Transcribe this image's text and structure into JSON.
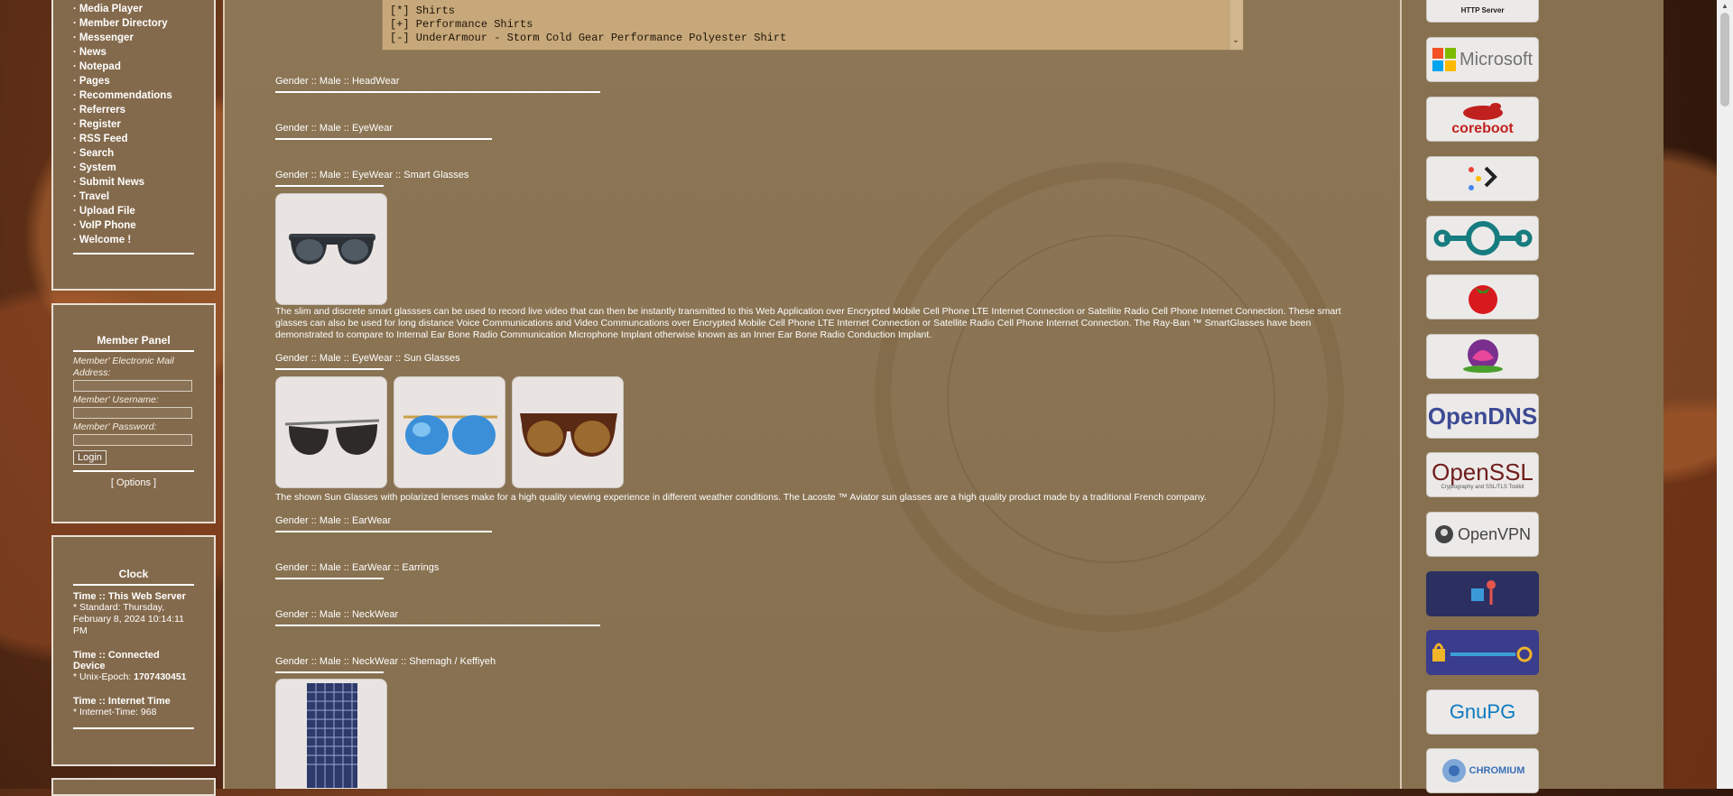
{
  "nav": {
    "items": [
      "Media Player",
      "Member Directory",
      "Messenger",
      "News",
      "Notepad",
      "Pages",
      "Recommendations",
      "Referrers",
      "Register",
      "RSS Feed",
      "Search",
      "System",
      "Submit News",
      "Travel",
      "Upload File",
      "VoIP Phone",
      "Welcome !"
    ],
    "bullet": "·"
  },
  "member_panel": {
    "title": "Member Panel",
    "email_label": "Member' Electronic Mail Address:",
    "username_label": "Member' Username:",
    "password_label": "Member' Password:",
    "login_label": "Login",
    "options_label": "[ Options ]"
  },
  "clock": {
    "title": "Clock",
    "server_heading": "Time :: This Web Server",
    "server_text": "* Standard: Thursday, February 8, 2024 10:14:11 PM",
    "device_heading": "Time :: Connected Device",
    "device_prefix": "* Unix-Epoch: ",
    "device_value": "1707430451",
    "internet_heading": "Time :: Internet Time",
    "internet_text": "* Internet-Time: 968"
  },
  "textbox": {
    "lines": [
      "[*] Shirts",
      "[+] Performance Shirts",
      "[-] UnderArmour - Storm Cold Gear Performance Polyester Shirt"
    ],
    "scroll_arrow": "⌄"
  },
  "sections": [
    {
      "title": "Gender :: Male :: HeadWear"
    },
    {
      "title": "Gender :: Male :: EyeWear"
    },
    {
      "title": "Gender :: Male :: EyeWear :: Smart Glasses"
    },
    {
      "title": "Gender :: Male :: EyeWear :: Sun Glasses"
    },
    {
      "title": "Gender :: Male :: EarWear"
    },
    {
      "title": "Gender :: Male :: EarWear :: Earrings"
    },
    {
      "title": "Gender :: Male :: NeckWear"
    },
    {
      "title": "Gender :: Male :: NeckWear :: Shemagh / Keffiyeh"
    }
  ],
  "descriptions": {
    "smart_glasses": "The slim and discrete smart glassses can be used to record live video that can then be instantly transmitted to this Web Application over Encrypted Mobile Cell Phone LTE Internet Connection or Satellite Radio Cell Phone Internet Connection. These smart glasses can also be used for long distance Voice Communications and Video Communcations over Encrypted Mobile Cell Phone LTE Internet Connection or Satellite Radio Cell Phone Internet Connection. The Ray-Ban ™ SmartGlasses have been demonstrated to compare to Internal Ear Bone Radio Communication Microphone Implant otherwise known as an Inner Ear Bone Radio Conduction Implant.",
    "sun_glasses": "The shown Sun Glasses with polarized lenses make for a high quality viewing experience in different weather conditions. The Lacoste ™ Aviator sun glasses are a high quality product made by a traditional French company."
  },
  "logos": {
    "http_server": "HTTP Server",
    "microsoft": "Microsoft",
    "coreboot": "coreboot",
    "opendns": "OpenDNS",
    "openssl": "OpenSSL",
    "openssl_sub": "Cryptography and SSL/TLS Toolkit",
    "openvpn": "OpenVPN",
    "gnupg": "GnuPG",
    "chromium": "CHROMIUM"
  },
  "colors": {
    "panel_bg": "#846a4c",
    "content_bg": "#8c7656",
    "textbox_bg": "#c7a87a"
  }
}
